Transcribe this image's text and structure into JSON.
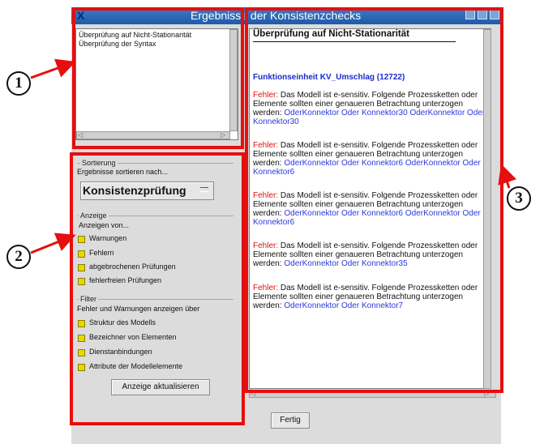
{
  "window": {
    "title": "Ergebnisse der Konsistenzchecks",
    "close_glyph": "X"
  },
  "check_list": {
    "items": [
      "Überprüfung auf Nicht-Stationarität",
      "Überprüfung der Syntax"
    ]
  },
  "sorting": {
    "group_title": "Sortierung",
    "caption": "Ergebnisse sortieren nach...",
    "selected": "Konsistenzprüfung"
  },
  "display": {
    "group_title": "Anzeige",
    "caption": "Anzeigen von...",
    "options": [
      "Warnungen",
      "Fehlern",
      "abgebrochenen Prüfungen",
      "fehlerfreien Prüfungen"
    ]
  },
  "filter": {
    "group_title": "Filter",
    "caption": "Fehler und Warnungen anzeigen über",
    "options": [
      "Struktur des Modells",
      "Bezeichner von Elementen",
      "Dienstanbindungen",
      "Attribute der Modellelemente"
    ]
  },
  "refresh_button": "Anzeige aktualisieren",
  "results": {
    "heading": "Überprüfung auf Nicht-Stationarität",
    "unit": "Funktionseinheit KV_Umschlag (12722)",
    "errors": [
      {
        "label": "Fehler:",
        "text": " Das Modell ist e-sensitiv. Folgende Prozessketten oder Elemente sollten einer genaueren Betrachtung unterzogen werden: ",
        "links": "OderKonnektor Oder Konnektor30 OderKonnektor Oder Konnektor30"
      },
      {
        "label": "Fehler:",
        "text": " Das Modell ist e-sensitiv. Folgende Prozessketten oder Elemente sollten einer genaueren Betrachtung unterzogen werden: ",
        "links": "OderKonnektor Oder Konnektor6 OderKonnektor Oder Konnektor6"
      },
      {
        "label": "Fehler:",
        "text": " Das Modell ist e-sensitiv. Folgende Prozessketten oder Elemente sollten einer genaueren Betrachtung unterzogen werden: ",
        "links": "OderKonnektor Oder Konnektor6 OderKonnektor Oder Konnektor6"
      },
      {
        "label": "Fehler:",
        "text": " Das Modell ist e-sensitiv. Folgende Prozessketten oder Elemente sollten einer genaueren Betrachtung unterzogen werden: ",
        "links": "OderKonnektor Oder Konnektor35"
      },
      {
        "label": "Fehler:",
        "text": " Das Modell ist e-sensitiv. Folgende Prozessketten oder Elemente sollten einer genaueren Betrachtung unterzogen werden: ",
        "links": "OderKonnektor Oder Konnektor7"
      }
    ]
  },
  "done_button": "Fertig",
  "annotations": {
    "markers": [
      "1",
      "2",
      "3"
    ],
    "color": "#e60e0e"
  },
  "colors": {
    "error_label": "#e01010",
    "link": "#2a3adc",
    "checkbox": "#e8d800",
    "titlebar": "#1f5aa8"
  }
}
